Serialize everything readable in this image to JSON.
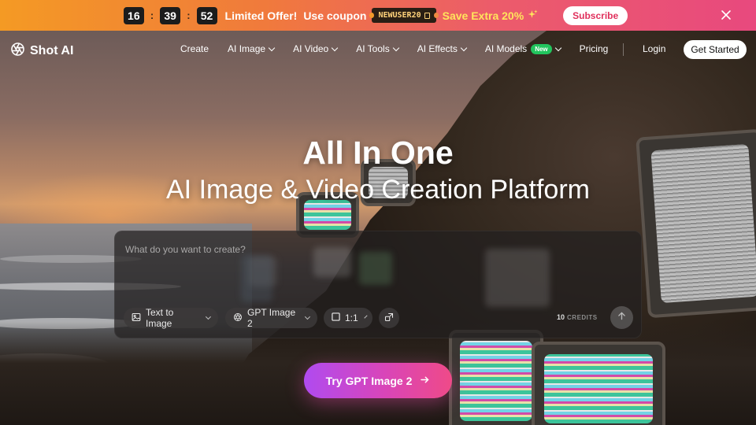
{
  "promo": {
    "countdown": {
      "hours": "16",
      "minutes": "39",
      "seconds": "52",
      "separator": ":"
    },
    "offer_text": "Limited Offer!",
    "use_text": "Use coupon",
    "coupon_code": "NEWUSER20",
    "save_text": "Save Extra 20%",
    "subscribe_label": "Subscribe"
  },
  "nav": {
    "brand": "Shot AI",
    "items": [
      {
        "label": "Create",
        "dropdown": false
      },
      {
        "label": "AI Image",
        "dropdown": true
      },
      {
        "label": "AI Video",
        "dropdown": true
      },
      {
        "label": "AI Tools",
        "dropdown": true
      },
      {
        "label": "AI Effects",
        "dropdown": true
      },
      {
        "label": "AI Models",
        "dropdown": true,
        "badge": "New"
      },
      {
        "label": "Pricing",
        "dropdown": false
      }
    ],
    "login_label": "Login",
    "cta_label": "Get Started"
  },
  "hero": {
    "title": "All In One",
    "subtitle": "AI Image & Video Creation Platform"
  },
  "prompt": {
    "placeholder": "What do you want to create?",
    "mode_label": "Text to Image",
    "model_label": "GPT Image 2",
    "ratio_label": "1:1",
    "credits_count": "10",
    "credits_label": "CREDITS"
  },
  "cta": {
    "label": "Try GPT Image 2"
  },
  "colors": {
    "promo_start": "#f49a24",
    "promo_end": "#e8497e",
    "coupon_text": "#ffd27a",
    "save_text": "#ffe45c",
    "new_badge": "#22c55e",
    "cta_start": "#b04bf0",
    "cta_end": "#ef4a88"
  },
  "icons": {
    "logo": "aperture-icon",
    "close": "close-icon",
    "copy": "copy-icon",
    "sparkle": "sparkle-icon",
    "chevron": "chevron-down-icon",
    "image": "image-icon",
    "model": "openai-icon",
    "ratio": "square-icon",
    "settings": "resize-icon",
    "send": "arrow-up-icon",
    "cta_arrow": "arrow-right-icon"
  }
}
